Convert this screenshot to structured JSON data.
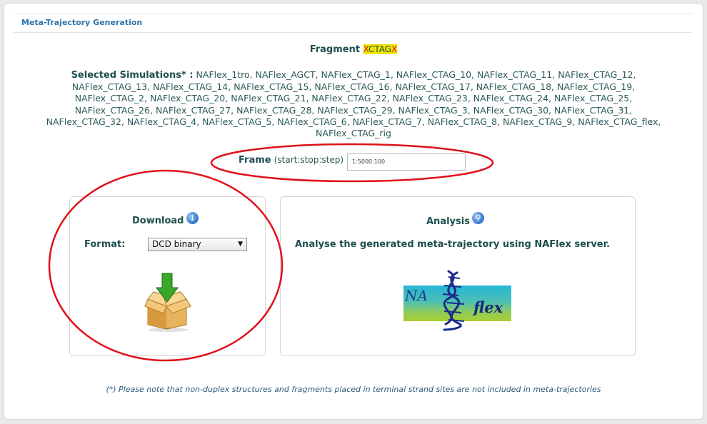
{
  "header": {
    "title": "Meta-Trajectory Generation"
  },
  "fragment": {
    "label": "Fragment",
    "seq_start": "X",
    "seq_mid": "CTAG",
    "seq_end": "X"
  },
  "simulations": {
    "label": "Selected Simulations* :",
    "list": "NAFlex_1tro, NAFlex_AGCT, NAFlex_CTAG_1, NAFlex_CTAG_10, NAFlex_CTAG_11, NAFlex_CTAG_12, NAFlex_CTAG_13, NAFlex_CTAG_14, NAFlex_CTAG_15, NAFlex_CTAG_16, NAFlex_CTAG_17, NAFlex_CTAG_18, NAFlex_CTAG_19, NAFlex_CTAG_2, NAFlex_CTAG_20, NAFlex_CTAG_21, NAFlex_CTAG_22, NAFlex_CTAG_23, NAFlex_CTAG_24, NAFlex_CTAG_25, NAFlex_CTAG_26, NAFlex_CTAG_27, NAFlex_CTAG_28, NAFlex_CTAG_29, NAFlex_CTAG_3, NAFlex_CTAG_30, NAFlex_CTAG_31, NAFlex_CTAG_32, NAFlex_CTAG_4, NAFlex_CTAG_5, NAFlex_CTAG_6, NAFlex_CTAG_7, NAFlex_CTAG_8, NAFlex_CTAG_9, NAFlex_CTAG_flex, NAFlex_CTAG_rig"
  },
  "frame": {
    "label": "Frame",
    "hint": "(start:stop:step)",
    "value": "1:5000:100"
  },
  "download": {
    "title": "Download",
    "format_label": "Format:",
    "format_selected": "DCD binary",
    "icon": "download-circle-icon",
    "image_icon": "box-download-icon"
  },
  "analysis": {
    "title": "Analysis",
    "icon": "magnifier-circle-icon",
    "text": "Analyse the generated meta-trajectory using NAFlex server.",
    "logo_left": "NA",
    "logo_right": "flex"
  },
  "footnote": "(*) Please note that non-duplex structures and fragments placed in terminal strand sites are not included in meta-trajectories",
  "colors": {
    "title_blue": "#2e73ab",
    "text_teal": "#1f4f4f",
    "highlight_yellow": "#f3e400",
    "annotation_red": "#e0101a"
  }
}
